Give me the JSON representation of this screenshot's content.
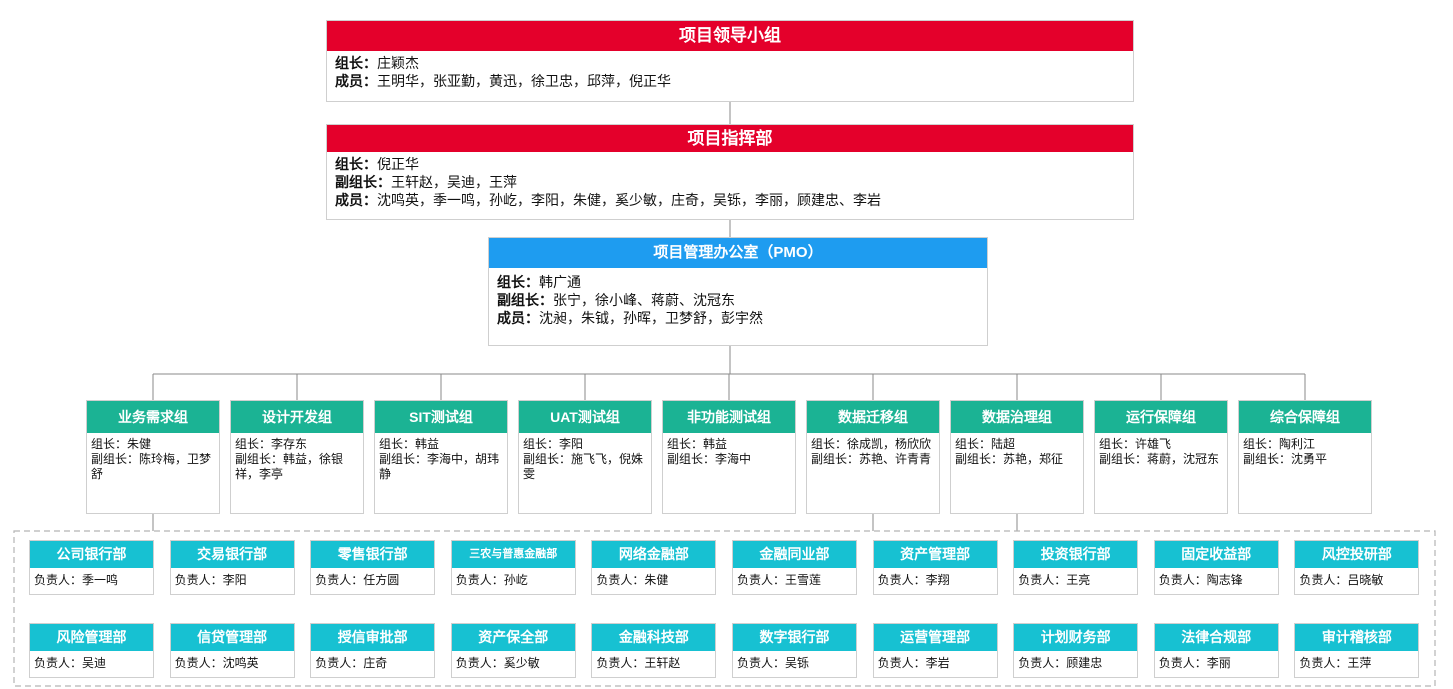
{
  "leadership": {
    "title": "项目领导小组",
    "lines": [
      {
        "label": "组长：",
        "text": "庄颖杰"
      },
      {
        "label": "成员：",
        "text": "王明华，张亚勤，黄迅，徐卫忠，邱萍，倪正华"
      }
    ]
  },
  "command": {
    "title": "项目指挥部",
    "lines": [
      {
        "label": "组长：",
        "text": "倪正华"
      },
      {
        "label": "副组长：",
        "text": "王轩赵，吴迪，王萍"
      },
      {
        "label": "成员：",
        "text": "沈鸣英，季一鸣，孙屹，李阳，朱健，奚少敏，庄奇，吴铄，李丽，顾建忠、李岩"
      }
    ]
  },
  "pmo": {
    "title": "项目管理办公室（PMO）",
    "lines": [
      {
        "label": "组长：",
        "text": "韩广通"
      },
      {
        "label": "副组长：",
        "text": "张宁，徐小峰、蒋蔚、沈冠东"
      },
      {
        "label": "成员：",
        "text": "沈昶，朱钺，孙晖，卫梦舒，彭宇然"
      }
    ]
  },
  "groups": [
    {
      "name": "业务需求组",
      "lines": [
        "组长：朱健",
        "副组长：陈玲梅，卫梦舒"
      ]
    },
    {
      "name": "设计开发组",
      "lines": [
        "组长：李存东",
        "副组长：韩益，徐银祥，李亭"
      ]
    },
    {
      "name": "SIT测试组",
      "lines": [
        "组长：韩益",
        "副组长：李海中，胡玮静"
      ]
    },
    {
      "name": "UAT测试组",
      "lines": [
        "组长：李阳",
        "副组长：施飞飞，倪姝雯"
      ]
    },
    {
      "name": "非功能测试组",
      "lines": [
        "组长：韩益",
        "副组长：李海中"
      ]
    },
    {
      "name": "数据迁移组",
      "lines": [
        "组长：徐成凯，杨欣欣",
        "副组长：苏艳、许青青"
      ]
    },
    {
      "name": "数据治理组",
      "lines": [
        "组长：陆超",
        "副组长：苏艳，郑征"
      ]
    },
    {
      "name": "运行保障组",
      "lines": [
        "组长：许雄飞",
        "副组长：蒋蔚，沈冠东"
      ]
    },
    {
      "name": "综合保障组",
      "lines": [
        "组长：陶利江",
        "副组长：沈勇平"
      ]
    }
  ],
  "departments": [
    {
      "name": "公司银行部",
      "owner": "负责人：季一鸣"
    },
    {
      "name": "交易银行部",
      "owner": "负责人：李阳"
    },
    {
      "name": "零售银行部",
      "owner": "负责人：任方圆"
    },
    {
      "name": "三农与普惠金融部",
      "owner": "负责人：孙屹"
    },
    {
      "name": "网络金融部",
      "owner": "负责人：朱健"
    },
    {
      "name": "金融同业部",
      "owner": "负责人：王雪莲"
    },
    {
      "name": "资产管理部",
      "owner": "负责人：李翔"
    },
    {
      "name": "投资银行部",
      "owner": "负责人：王亮"
    },
    {
      "name": "固定收益部",
      "owner": "负责人：陶志锋"
    },
    {
      "name": "风控投研部",
      "owner": "负责人：吕晓敏"
    },
    {
      "name": "风险管理部",
      "owner": "负责人：吴迪"
    },
    {
      "name": "信贷管理部",
      "owner": "负责人：沈鸣英"
    },
    {
      "name": "授信审批部",
      "owner": "负责人：庄奇"
    },
    {
      "name": "资产保全部",
      "owner": "负责人：奚少敏"
    },
    {
      "name": "金融科技部",
      "owner": "负责人：王轩赵"
    },
    {
      "name": "数字银行部",
      "owner": "负责人：吴铄"
    },
    {
      "name": "运营管理部",
      "owner": "负责人：李岩"
    },
    {
      "name": "计划财务部",
      "owner": "负责人：顾建忠"
    },
    {
      "name": "法律合规部",
      "owner": "负责人：李丽"
    },
    {
      "name": "审计稽核部",
      "owner": "负责人：王萍"
    }
  ],
  "colors": {
    "leadership_header": "#e4002b",
    "pmo_header": "#1e9cf0",
    "group_header": "#1bb394",
    "department_header": "#17c1d2"
  }
}
